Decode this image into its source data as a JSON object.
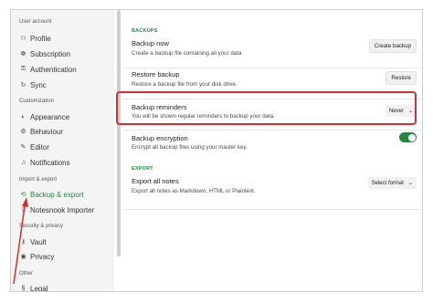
{
  "sidebar": {
    "sections": [
      {
        "title": "User account",
        "items": [
          {
            "icon": "profile-icon",
            "glyph": "⚇",
            "label": "Profile"
          },
          {
            "icon": "subscription-icon",
            "glyph": "☸",
            "label": "Subscription"
          },
          {
            "icon": "authentication-icon",
            "glyph": "⚿",
            "label": "Authentication"
          },
          {
            "icon": "sync-icon",
            "glyph": "↻",
            "label": "Sync"
          }
        ]
      },
      {
        "title": "Customization",
        "items": [
          {
            "icon": "appearance-icon",
            "glyph": "◐",
            "label": "Appearance"
          },
          {
            "icon": "behaviour-icon",
            "glyph": "⚙",
            "label": "Behaviour"
          },
          {
            "icon": "editor-icon",
            "glyph": "✎",
            "label": "Editor"
          },
          {
            "icon": "notifications-icon",
            "glyph": "♫",
            "label": "Notifications"
          }
        ]
      },
      {
        "title": "Import & export",
        "items": [
          {
            "icon": "backup-restore-icon",
            "glyph": "⟲",
            "label": "Backup & export",
            "active": true
          },
          {
            "icon": "importer-icon",
            "glyph": "⇩",
            "label": "Notesnook Importer"
          }
        ]
      },
      {
        "title": "Security & privacy",
        "items": [
          {
            "icon": "vault-icon",
            "glyph": "⚷",
            "label": "Vault"
          },
          {
            "icon": "privacy-icon",
            "glyph": "◉",
            "label": "Privacy"
          }
        ]
      },
      {
        "title": "Other",
        "items": [
          {
            "icon": "legal-icon",
            "glyph": "§",
            "label": "Legal"
          }
        ]
      }
    ]
  },
  "main": {
    "backups_label": "BACKUPS",
    "backup_now": {
      "title": "Backup now",
      "desc": "Create a backup file containing all your data",
      "button": "Create backup"
    },
    "restore_backup": {
      "title": "Restore backup",
      "desc": "Restore a backup file from your disk drive.",
      "button": "Restore"
    },
    "backup_reminders": {
      "title": "Backup reminders",
      "desc": "You will be shown regular reminders to backup your data.",
      "selected": "Never"
    },
    "backup_encryption": {
      "title": "Backup encryption",
      "desc": "Encrypt all backup files using your master key.",
      "enabled": true
    },
    "export_label": "EXPORT",
    "export_all": {
      "title": "Export all notes",
      "desc": "Export all notes as Markdown, HTML or Plaintext.",
      "selected": "Select format"
    }
  },
  "annotation": {
    "highlight_color": "#d62d2d"
  },
  "colors": {
    "accent": "#1f8a3c"
  }
}
